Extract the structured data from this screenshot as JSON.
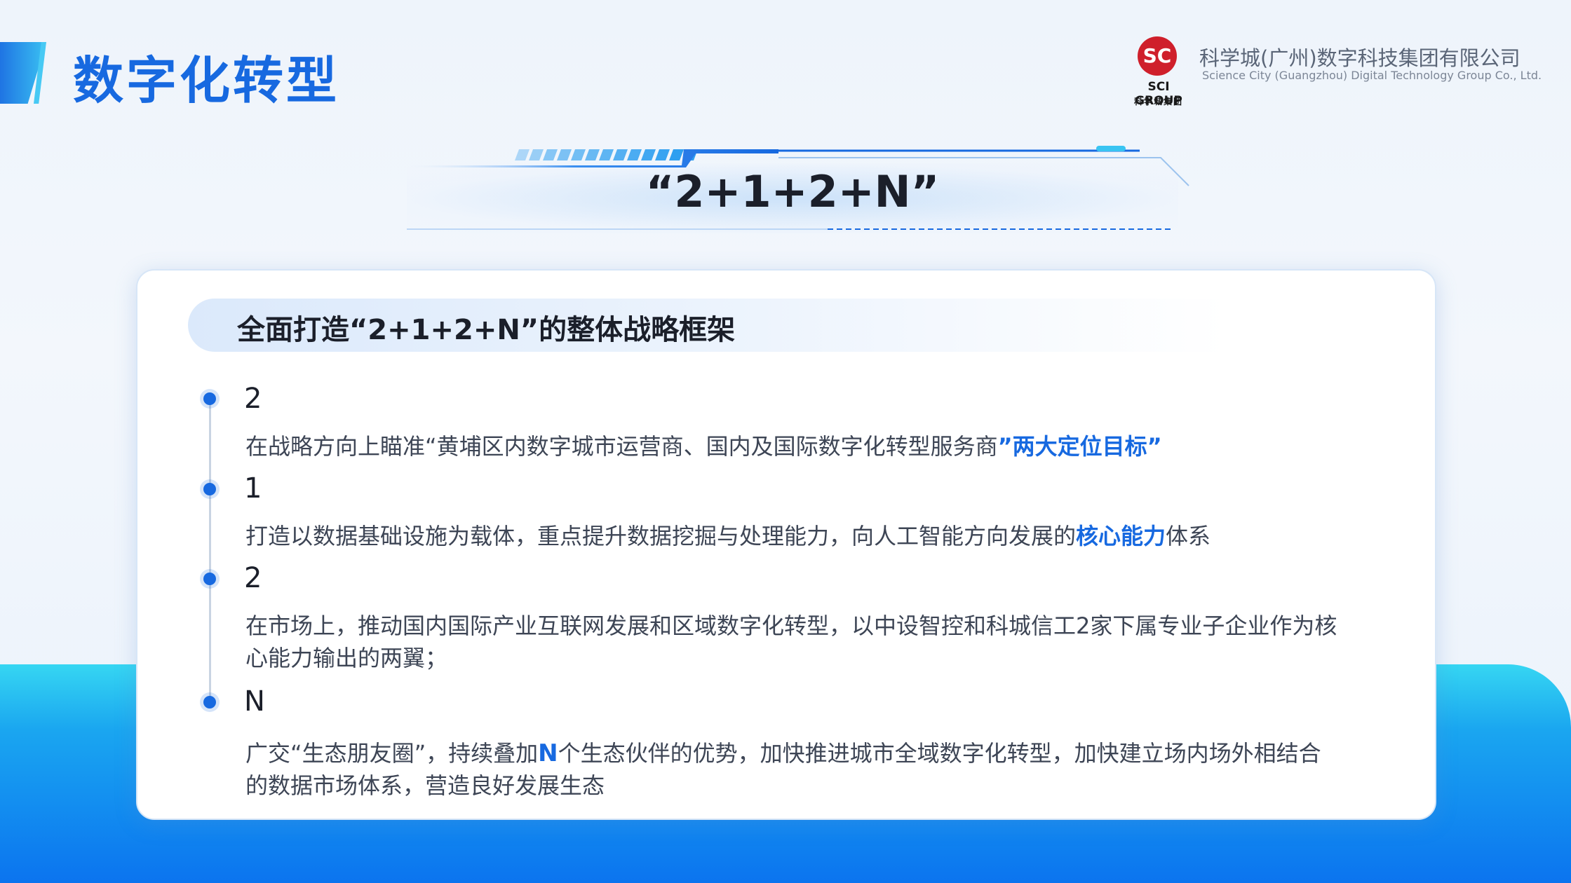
{
  "header": {
    "title": "数字化转型",
    "logo_en": "SCI GROUP",
    "logo_cn": "科学城集团",
    "logo_mark": "SC",
    "company_cn": "科学城(广州)数字科技集团有限公司",
    "company_en": "Science City (Guangzhou) Digital Technology Group Co., Ltd."
  },
  "banner": {
    "title": "“2+1+2+N”"
  },
  "card": {
    "heading": "全面打造“2+1+2+N”的整体战略框架",
    "items": [
      {
        "label": "2",
        "desc_before": "在战略方向上瞄准“黄埔区内数字城市运营商、国内及国际数字化转型服务商",
        "desc_highlight": "”两大定位目标”",
        "desc_after": ""
      },
      {
        "label": "1",
        "desc_before": "打造以数据基础设施为载体，重点提升数据挖掘与处理能力，向人工智能方向发展的",
        "desc_highlight": "核心能力",
        "desc_after": "体系"
      },
      {
        "label": "2",
        "desc_before": "在市场上，推动国内国际产业互联网发展和区域数字化转型，以中设智控和科城信工2家下属专业子企业作为核心能力输出的两翼；",
        "desc_highlight": "",
        "desc_after": ""
      },
      {
        "label": "N",
        "desc_before": "广交“生态朋友圈”，持续叠加",
        "desc_highlight": "N",
        "desc_after": "个生态伙伴的优势，加快推进城市全域数字化转型，加快建立场内场外相结合的数据市场体系，营造良好发展生态"
      }
    ]
  },
  "colors": {
    "accent": "#1769e0",
    "logo_red": "#cf1f2b",
    "band_cyan": "#36d6f2",
    "band_blue": "#0b74ef"
  }
}
